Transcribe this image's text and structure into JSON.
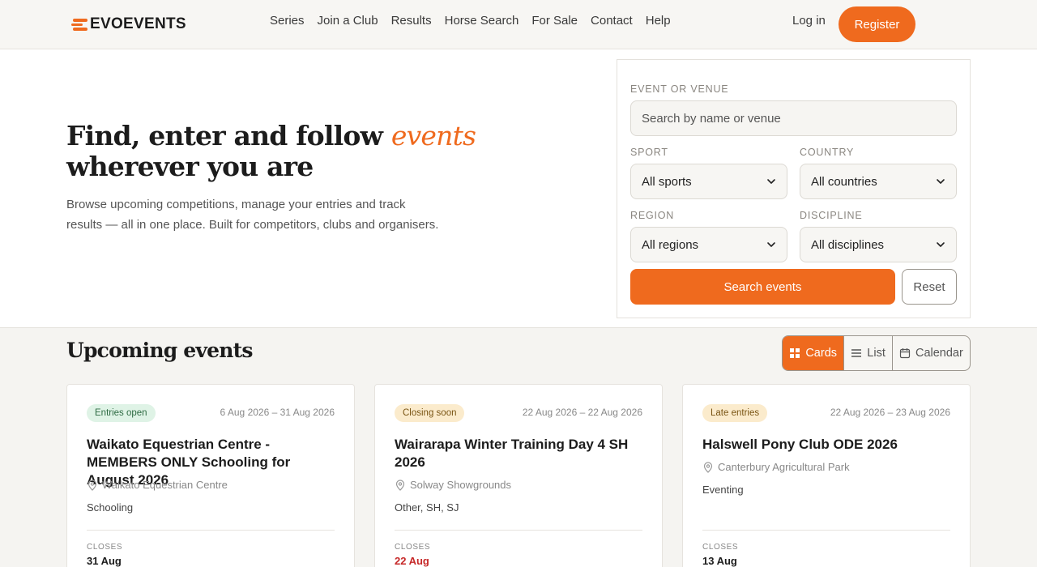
{
  "brand": {
    "name": "EVOEVENTS",
    "accent": "#ef6a1e"
  },
  "nav": {
    "items": [
      "Series",
      "Join a Club",
      "Results",
      "Horse Search",
      "For Sale",
      "Contact",
      "Help"
    ],
    "login": "Log in",
    "register": "Register"
  },
  "hero": {
    "title_before": "Find, enter and follow ",
    "title_accent": "events",
    "title_after": " wherever you are",
    "subtitle": "Browse upcoming competitions, manage your entries and track results — all in one place. Built for competitors, clubs and organisers."
  },
  "search": {
    "event_label": "Event or venue",
    "event_placeholder": "Search by name or venue",
    "sport_label": "Sport",
    "sport_value": "All sports",
    "country_label": "Country",
    "country_value": "All countries",
    "region_label": "Region",
    "region_value": "All regions",
    "discipline_label": "Discipline",
    "discipline_value": "All disciplines",
    "submit": "Search events",
    "reset": "Reset"
  },
  "upcoming": {
    "title": "Upcoming events",
    "views": [
      "Cards",
      "List",
      "Calendar"
    ],
    "active_view": "Cards",
    "closes_label": "Closes",
    "cards": [
      {
        "status": "Entries open",
        "dates": "6 Aug 2026 – 31 Aug 2026",
        "title": "Waikato Equestrian Centre - MEMBERS ONLY Schooling for August 2026",
        "venue": "Waikato Equestrian Centre",
        "discipline": "Schooling",
        "closes": "31 Aug"
      },
      {
        "status": "Closing soon",
        "dates": "22 Aug 2026 – 22 Aug 2026",
        "title": "Wairarapa Winter Training Day 4 SH 2026",
        "venue": "Solway Showgrounds",
        "discipline": "Other, SH, SJ",
        "closes": "22 Aug"
      },
      {
        "status": "Late entries",
        "dates": "22 Aug 2026 – 23 Aug 2026",
        "title": "Halswell Pony Club ODE 2026",
        "venue": "Canterbury Agricultural Park",
        "discipline": "Eventing",
        "closes": "13 Aug"
      }
    ]
  }
}
